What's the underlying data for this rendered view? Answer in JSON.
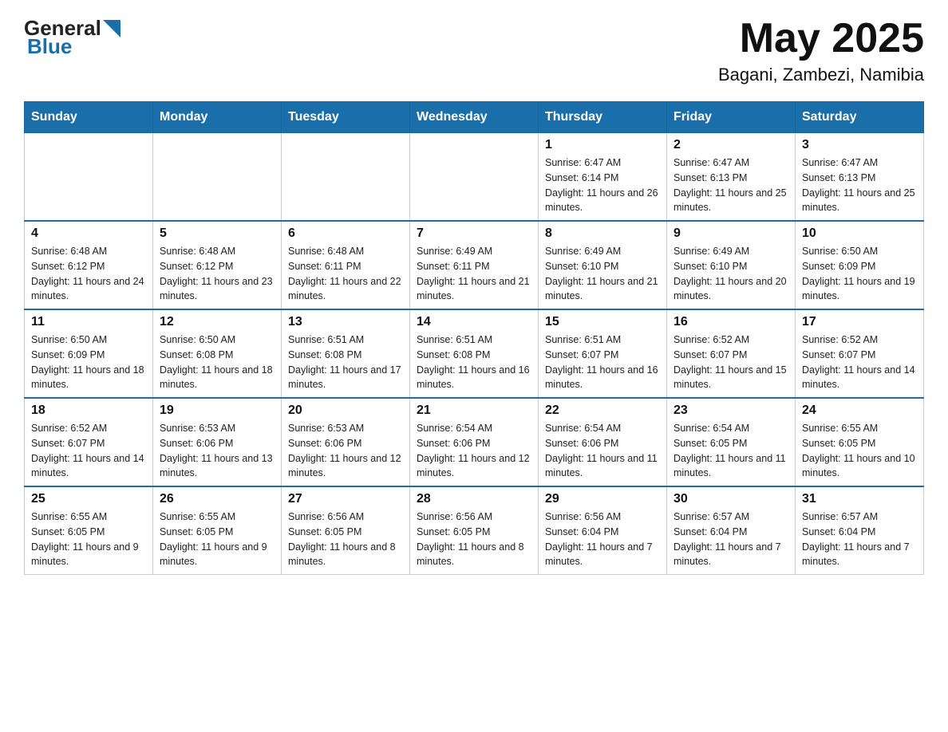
{
  "header": {
    "logo": {
      "general": "General",
      "blue": "Blue"
    },
    "title": "May 2025",
    "location": "Bagani, Zambezi, Namibia"
  },
  "weekdays": [
    "Sunday",
    "Monday",
    "Tuesday",
    "Wednesday",
    "Thursday",
    "Friday",
    "Saturday"
  ],
  "weeks": [
    [
      {
        "day": "",
        "info": ""
      },
      {
        "day": "",
        "info": ""
      },
      {
        "day": "",
        "info": ""
      },
      {
        "day": "",
        "info": ""
      },
      {
        "day": "1",
        "info": "Sunrise: 6:47 AM\nSunset: 6:14 PM\nDaylight: 11 hours and 26 minutes."
      },
      {
        "day": "2",
        "info": "Sunrise: 6:47 AM\nSunset: 6:13 PM\nDaylight: 11 hours and 25 minutes."
      },
      {
        "day": "3",
        "info": "Sunrise: 6:47 AM\nSunset: 6:13 PM\nDaylight: 11 hours and 25 minutes."
      }
    ],
    [
      {
        "day": "4",
        "info": "Sunrise: 6:48 AM\nSunset: 6:12 PM\nDaylight: 11 hours and 24 minutes."
      },
      {
        "day": "5",
        "info": "Sunrise: 6:48 AM\nSunset: 6:12 PM\nDaylight: 11 hours and 23 minutes."
      },
      {
        "day": "6",
        "info": "Sunrise: 6:48 AM\nSunset: 6:11 PM\nDaylight: 11 hours and 22 minutes."
      },
      {
        "day": "7",
        "info": "Sunrise: 6:49 AM\nSunset: 6:11 PM\nDaylight: 11 hours and 21 minutes."
      },
      {
        "day": "8",
        "info": "Sunrise: 6:49 AM\nSunset: 6:10 PM\nDaylight: 11 hours and 21 minutes."
      },
      {
        "day": "9",
        "info": "Sunrise: 6:49 AM\nSunset: 6:10 PM\nDaylight: 11 hours and 20 minutes."
      },
      {
        "day": "10",
        "info": "Sunrise: 6:50 AM\nSunset: 6:09 PM\nDaylight: 11 hours and 19 minutes."
      }
    ],
    [
      {
        "day": "11",
        "info": "Sunrise: 6:50 AM\nSunset: 6:09 PM\nDaylight: 11 hours and 18 minutes."
      },
      {
        "day": "12",
        "info": "Sunrise: 6:50 AM\nSunset: 6:08 PM\nDaylight: 11 hours and 18 minutes."
      },
      {
        "day": "13",
        "info": "Sunrise: 6:51 AM\nSunset: 6:08 PM\nDaylight: 11 hours and 17 minutes."
      },
      {
        "day": "14",
        "info": "Sunrise: 6:51 AM\nSunset: 6:08 PM\nDaylight: 11 hours and 16 minutes."
      },
      {
        "day": "15",
        "info": "Sunrise: 6:51 AM\nSunset: 6:07 PM\nDaylight: 11 hours and 16 minutes."
      },
      {
        "day": "16",
        "info": "Sunrise: 6:52 AM\nSunset: 6:07 PM\nDaylight: 11 hours and 15 minutes."
      },
      {
        "day": "17",
        "info": "Sunrise: 6:52 AM\nSunset: 6:07 PM\nDaylight: 11 hours and 14 minutes."
      }
    ],
    [
      {
        "day": "18",
        "info": "Sunrise: 6:52 AM\nSunset: 6:07 PM\nDaylight: 11 hours and 14 minutes."
      },
      {
        "day": "19",
        "info": "Sunrise: 6:53 AM\nSunset: 6:06 PM\nDaylight: 11 hours and 13 minutes."
      },
      {
        "day": "20",
        "info": "Sunrise: 6:53 AM\nSunset: 6:06 PM\nDaylight: 11 hours and 12 minutes."
      },
      {
        "day": "21",
        "info": "Sunrise: 6:54 AM\nSunset: 6:06 PM\nDaylight: 11 hours and 12 minutes."
      },
      {
        "day": "22",
        "info": "Sunrise: 6:54 AM\nSunset: 6:06 PM\nDaylight: 11 hours and 11 minutes."
      },
      {
        "day": "23",
        "info": "Sunrise: 6:54 AM\nSunset: 6:05 PM\nDaylight: 11 hours and 11 minutes."
      },
      {
        "day": "24",
        "info": "Sunrise: 6:55 AM\nSunset: 6:05 PM\nDaylight: 11 hours and 10 minutes."
      }
    ],
    [
      {
        "day": "25",
        "info": "Sunrise: 6:55 AM\nSunset: 6:05 PM\nDaylight: 11 hours and 9 minutes."
      },
      {
        "day": "26",
        "info": "Sunrise: 6:55 AM\nSunset: 6:05 PM\nDaylight: 11 hours and 9 minutes."
      },
      {
        "day": "27",
        "info": "Sunrise: 6:56 AM\nSunset: 6:05 PM\nDaylight: 11 hours and 8 minutes."
      },
      {
        "day": "28",
        "info": "Sunrise: 6:56 AM\nSunset: 6:05 PM\nDaylight: 11 hours and 8 minutes."
      },
      {
        "day": "29",
        "info": "Sunrise: 6:56 AM\nSunset: 6:04 PM\nDaylight: 11 hours and 7 minutes."
      },
      {
        "day": "30",
        "info": "Sunrise: 6:57 AM\nSunset: 6:04 PM\nDaylight: 11 hours and 7 minutes."
      },
      {
        "day": "31",
        "info": "Sunrise: 6:57 AM\nSunset: 6:04 PM\nDaylight: 11 hours and 7 minutes."
      }
    ]
  ]
}
